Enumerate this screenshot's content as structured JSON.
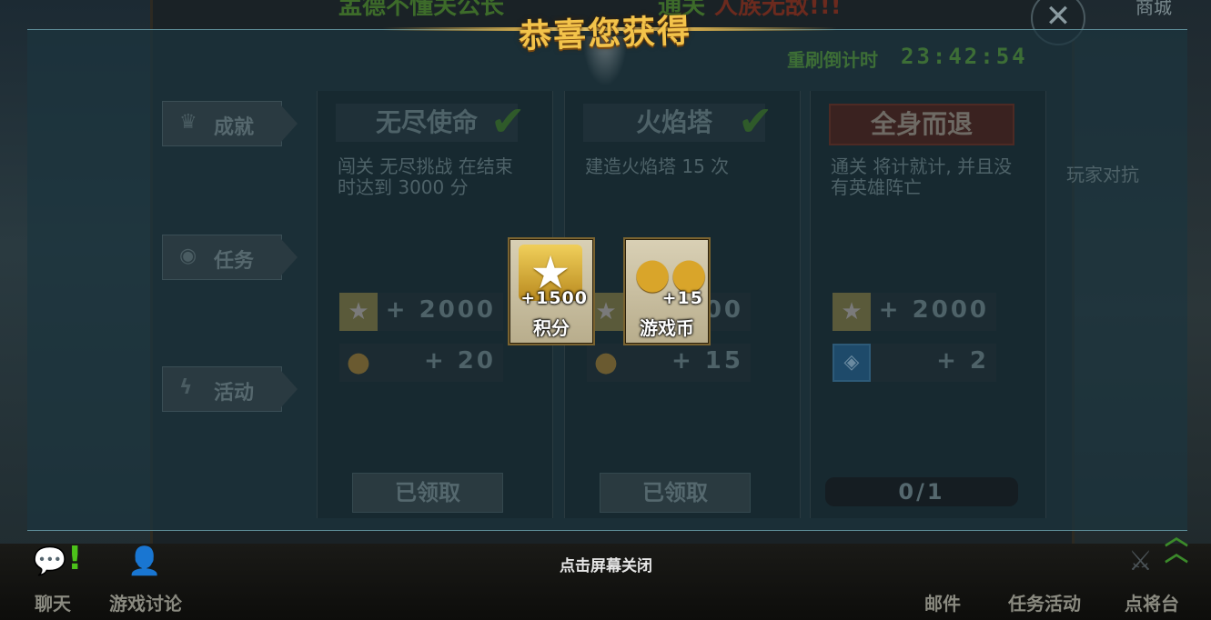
{
  "background": {
    "top_text_green": "孟德不懂关公长",
    "top_text_green_2": "通关",
    "top_text_red": "人族无敌!!!",
    "shop_label": "商城",
    "close_icon": "close-icon"
  },
  "timer": {
    "label": "重刷倒计时",
    "value": "23:42:54"
  },
  "side_tabs": [
    {
      "label": "成就",
      "icon": "crown-icon"
    },
    {
      "label": "任务",
      "icon": "eye-icon"
    },
    {
      "label": "活动",
      "icon": "lightning-icon"
    }
  ],
  "quests": [
    {
      "title": "无尽使命",
      "completed": true,
      "description": "闯关 无尽挑战 在结束时达到 3000 分",
      "rewards": [
        {
          "icon": "star-icon",
          "amount": "+ 2000"
        },
        {
          "icon": "coin-icon",
          "amount": "+ 20"
        }
      ],
      "button": "已领取"
    },
    {
      "title": "火焰塔",
      "completed": true,
      "description": "建造火焰塔 15 次",
      "rewards": [
        {
          "icon": "star-icon",
          "amount": "+ 2000"
        },
        {
          "icon": "coin-icon",
          "amount": "+ 15"
        }
      ],
      "button": "已领取"
    },
    {
      "title": "全身而退",
      "completed": false,
      "description": "通关 将计就计, 并且没有英雄阵亡",
      "rewards": [
        {
          "icon": "star-icon",
          "amount": "+ 2000"
        },
        {
          "icon": "badge-icon",
          "amount": "+ 2"
        }
      ],
      "progress": "0/1"
    }
  ],
  "behind_text": "玩家对抗",
  "popup": {
    "title": "恭喜您获得",
    "rewards": [
      {
        "icon": "star-icon",
        "amount": "+1500",
        "name": "积分"
      },
      {
        "icon": "coin-stack-icon",
        "amount": "+15",
        "name": "游戏币"
      }
    ],
    "close_hint": "点击屏幕关闭"
  },
  "bottom_nav": {
    "chat": "聊天",
    "discussion": "游戏讨论",
    "mail": "邮件",
    "task_activity": "任务活动",
    "hero": "点将台"
  },
  "colors": {
    "title_gold": "#f3c34a",
    "timer_green": "#3d6e36",
    "overlay": "#1c343f"
  }
}
